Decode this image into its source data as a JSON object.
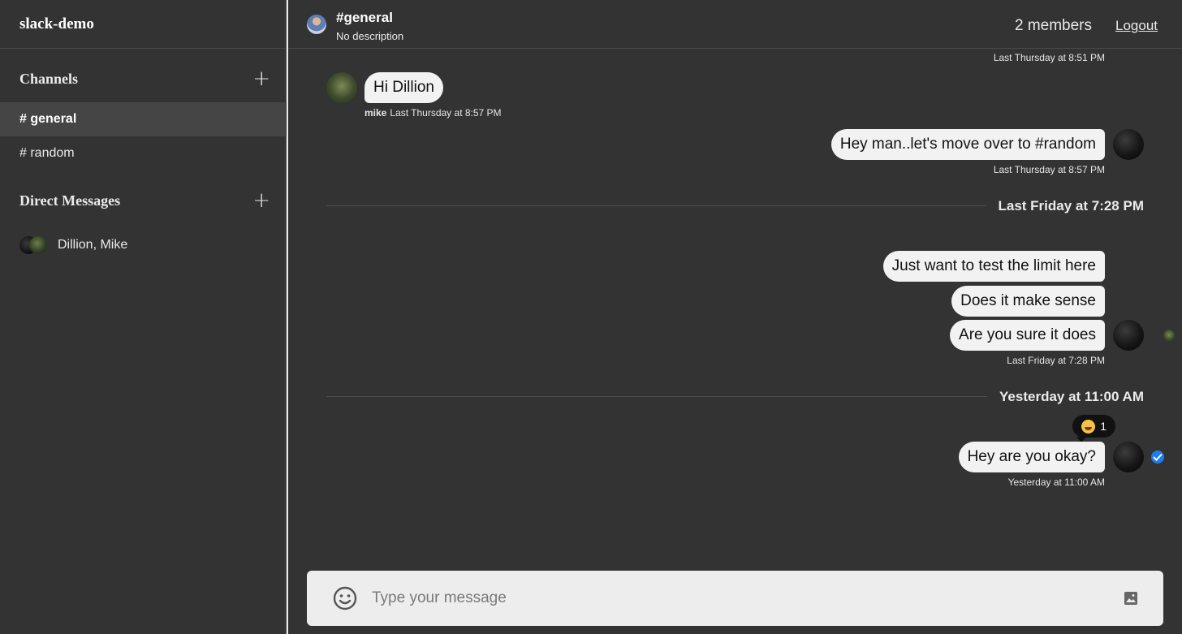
{
  "workspace": {
    "title": "slack-demo"
  },
  "sidebar": {
    "channels_title": "Channels",
    "channels": [
      {
        "label": "# general",
        "active": true
      },
      {
        "label": "# random",
        "active": false
      }
    ],
    "dm_title": "Direct Messages",
    "dms": [
      {
        "label": "Dillion, Mike"
      }
    ],
    "add_icon": "plus-icon"
  },
  "header": {
    "channel": "#general",
    "description": "No description",
    "members": "2 members",
    "logout": "Logout"
  },
  "messages": {
    "top_timestamp": "Last Thursday at 8:51 PM",
    "m1": {
      "text": "Hi Dillion",
      "sender": "mike",
      "time": "Last Thursday at 8:57 PM"
    },
    "m2": {
      "text": "Hey man..let's move over to #random",
      "time": "Last Thursday at 8:57 PM"
    },
    "sep1": "Last Friday at 7:28 PM",
    "group": {
      "lines": [
        "Just want to test the limit here",
        "Does it make sense",
        "Are you sure it does"
      ],
      "time": "Last Friday at 7:28 PM"
    },
    "sep2": "Yesterday at 11:00 AM",
    "m4": {
      "text": "Hey are you okay?",
      "time": "Yesterday at 11:00 AM",
      "reaction_count": "1",
      "reaction_icon": "laughing-emoji-icon"
    }
  },
  "composer": {
    "placeholder": "Type your message",
    "emoji_icon": "smiley-icon",
    "image_icon": "image-icon"
  },
  "colors": {
    "background": "#333333",
    "bubble": "#f2f2f2",
    "read_receipt": "#1f7cf0"
  }
}
